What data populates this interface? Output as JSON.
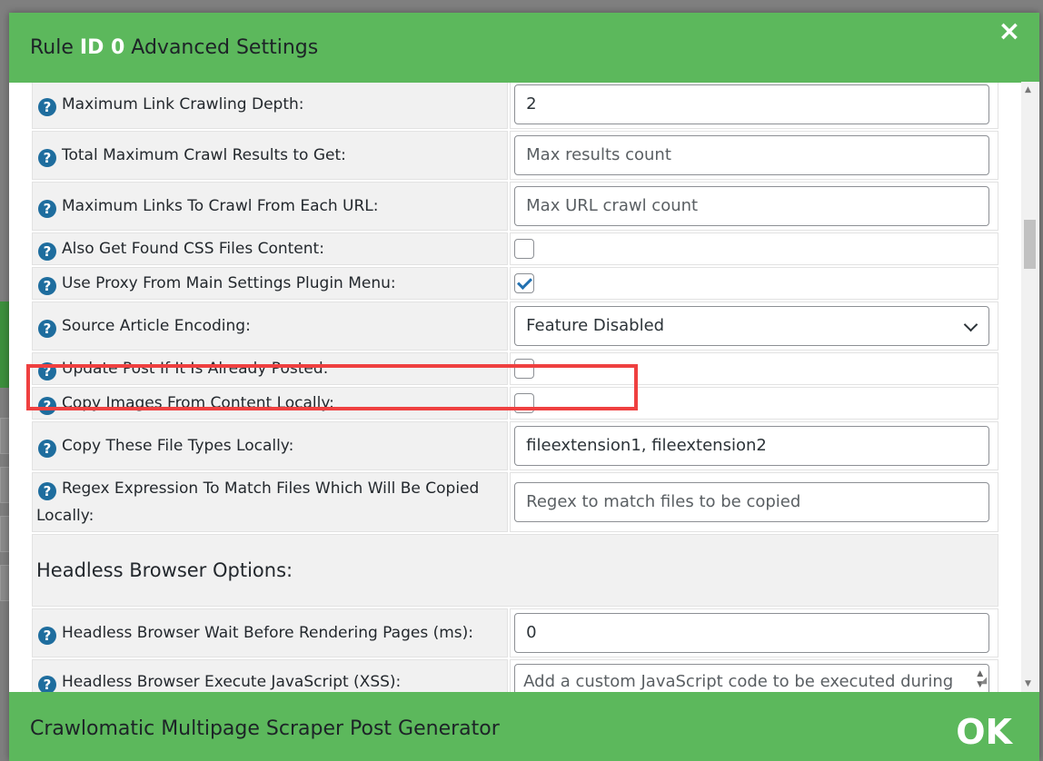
{
  "modal": {
    "title_prefix": "Rule ",
    "title_id": "ID 0",
    "title_suffix": " Advanced Settings",
    "close_label": "×",
    "footer_title": "Crawlomatic Multipage Scraper Post Generator",
    "ok_label": "OK"
  },
  "rows": {
    "max_depth": {
      "label": "Maximum Link Crawling Depth:",
      "value": "2"
    },
    "max_results": {
      "label": "Total Maximum Crawl Results to Get:",
      "placeholder": "Max results count"
    },
    "max_links": {
      "label": "Maximum Links To Crawl From Each URL:",
      "placeholder": "Max URL crawl count"
    },
    "css_files": {
      "label": "Also Get Found CSS Files Content:",
      "checked": false
    },
    "use_proxy": {
      "label": "Use Proxy From Main Settings Plugin Menu:",
      "checked": true
    },
    "encoding": {
      "label": "Source Article Encoding:",
      "selected": "Feature Disabled"
    },
    "update_post": {
      "label": "Update Post If It Is Already Posted:",
      "checked": false
    },
    "copy_images": {
      "label": "Copy Images From Content Locally:",
      "checked": false
    },
    "file_types": {
      "label": "Copy These File Types Locally:",
      "value": "fileextension1, fileextension2"
    },
    "regex": {
      "label": "Regex Expression To Match Files Which Will Be Copied Locally:",
      "placeholder": "Regex to match files to be copied"
    },
    "headless_section": "Headless Browser Options:",
    "headless_wait": {
      "label": "Headless Browser Wait Before Rendering Pages (ms):",
      "value": "0"
    },
    "headless_js": {
      "label": "Headless Browser Execute JavaScript (XSS):",
      "placeholder": "Add a custom JavaScript code to be executed during"
    }
  },
  "help_icon": "?",
  "colors": {
    "header_green": "#5cb85c",
    "highlight_red": "#ef4040",
    "help_blue": "#1e6d9e"
  }
}
